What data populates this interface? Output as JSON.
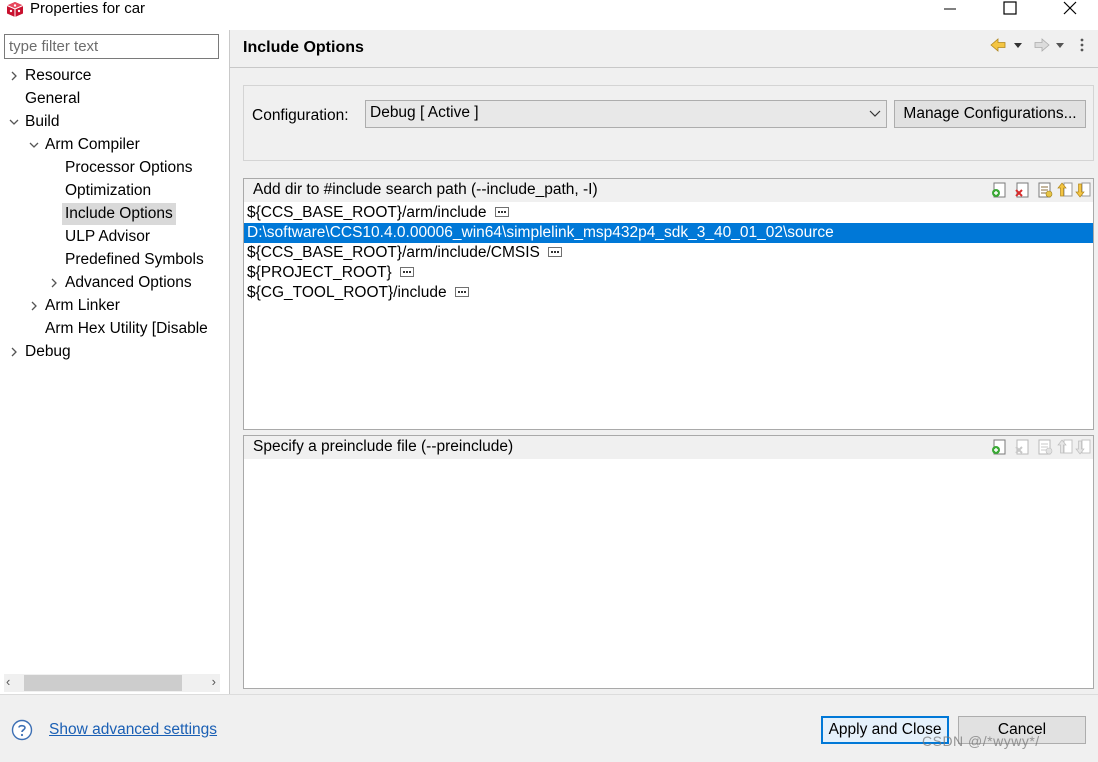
{
  "window": {
    "title": "Properties for car"
  },
  "filter": {
    "placeholder": "type filter text"
  },
  "tree": {
    "resource": "Resource",
    "general": "General",
    "build": "Build",
    "arm_compiler": "Arm Compiler",
    "processor_options": "Processor Options",
    "optimization": "Optimization",
    "include_options": "Include Options",
    "ulp_advisor": "ULP Advisor",
    "predefined_symbols": "Predefined Symbols",
    "advanced_options": "Advanced Options",
    "arm_linker": "Arm Linker",
    "arm_hex_utility": "Arm Hex Utility  [Disable",
    "debug": "Debug"
  },
  "page": {
    "title": "Include Options"
  },
  "configuration": {
    "label": "Configuration:",
    "selected": "Debug  [ Active ]",
    "manage_label": "Manage Configurations..."
  },
  "include_paths": {
    "title": "Add dir to #include search path (--include_path, -I)",
    "items": [
      {
        "path": "${CCS_BASE_ROOT}/arm/include"
      },
      {
        "path": "D:\\software\\CCS10.4.0.00006_win64\\simplelink_msp432p4_sdk_3_40_01_02\\source"
      },
      {
        "path": "${CCS_BASE_ROOT}/arm/include/CMSIS"
      },
      {
        "path": "${PROJECT_ROOT}"
      },
      {
        "path": "${CG_TOOL_ROOT}/include"
      }
    ]
  },
  "preinclude": {
    "title": "Specify a preinclude file (--preinclude)"
  },
  "bottom": {
    "advanced_link": "Show advanced settings",
    "apply_close": "Apply and Close",
    "cancel": "Cancel",
    "watermark": "CSDN @/*wywy*/"
  },
  "colors": {
    "selection": "#0078d7",
    "link": "#1a5fb4",
    "app_icon": "#c8102e"
  }
}
